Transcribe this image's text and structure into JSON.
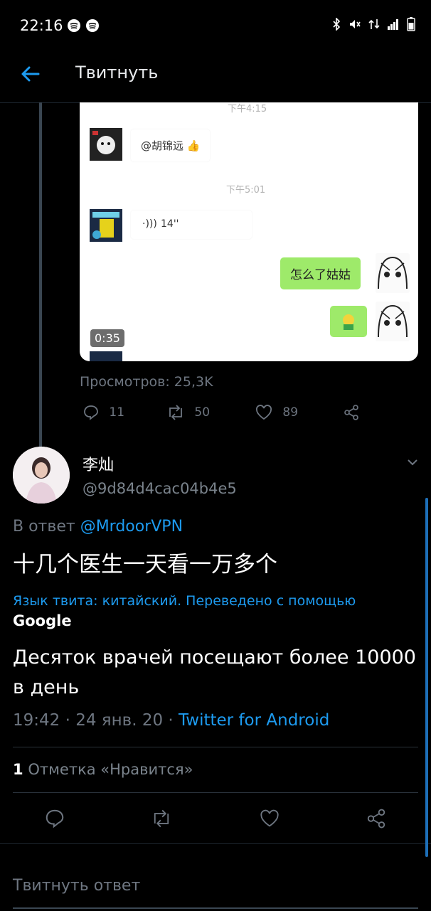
{
  "status_bar": {
    "time": "22:16",
    "left_icons": [
      "spotify-icon",
      "spotify-icon"
    ],
    "right_icons": [
      "bluetooth-icon",
      "mute-icon",
      "data-icon",
      "signal-icon",
      "battery-icon"
    ]
  },
  "header": {
    "title": "Твитнуть",
    "back_icon": "arrow-left-icon"
  },
  "media": {
    "chat": {
      "time1": "下午4:15",
      "msg1": "@胡锦远 👍",
      "time2": "下午5:01",
      "voice": "14''",
      "green1": "怎么了姑姑"
    },
    "duration": "0:35"
  },
  "parent_tweet": {
    "views": "Просмотров: 25,3K",
    "replies": "11",
    "retweets": "50",
    "likes": "89"
  },
  "reply_tweet": {
    "name": "李灿",
    "handle": "@9d84d4cac04b4e5",
    "replying_prefix": "В ответ",
    "replying_to": "@MrdoorVPN",
    "text": "十几个医生一天看一万多个",
    "translation_note": "Язык твита: китайский. Переведено с помощью",
    "translation_provider": "Google",
    "translated_text": "Десяток врачей посещают более 10000 в день",
    "timestamp": "19:42 · 24 янв. 20 ·",
    "via": "Twitter for Android",
    "likes_count": "1",
    "likes_label": "Отметка «Нравится»"
  },
  "reply_input": {
    "placeholder": "Твитнуть ответ"
  },
  "colors": {
    "accent": "#1d9bf0",
    "background": "#000000",
    "muted": "#6e7681",
    "chat_green": "#9eea6a"
  }
}
